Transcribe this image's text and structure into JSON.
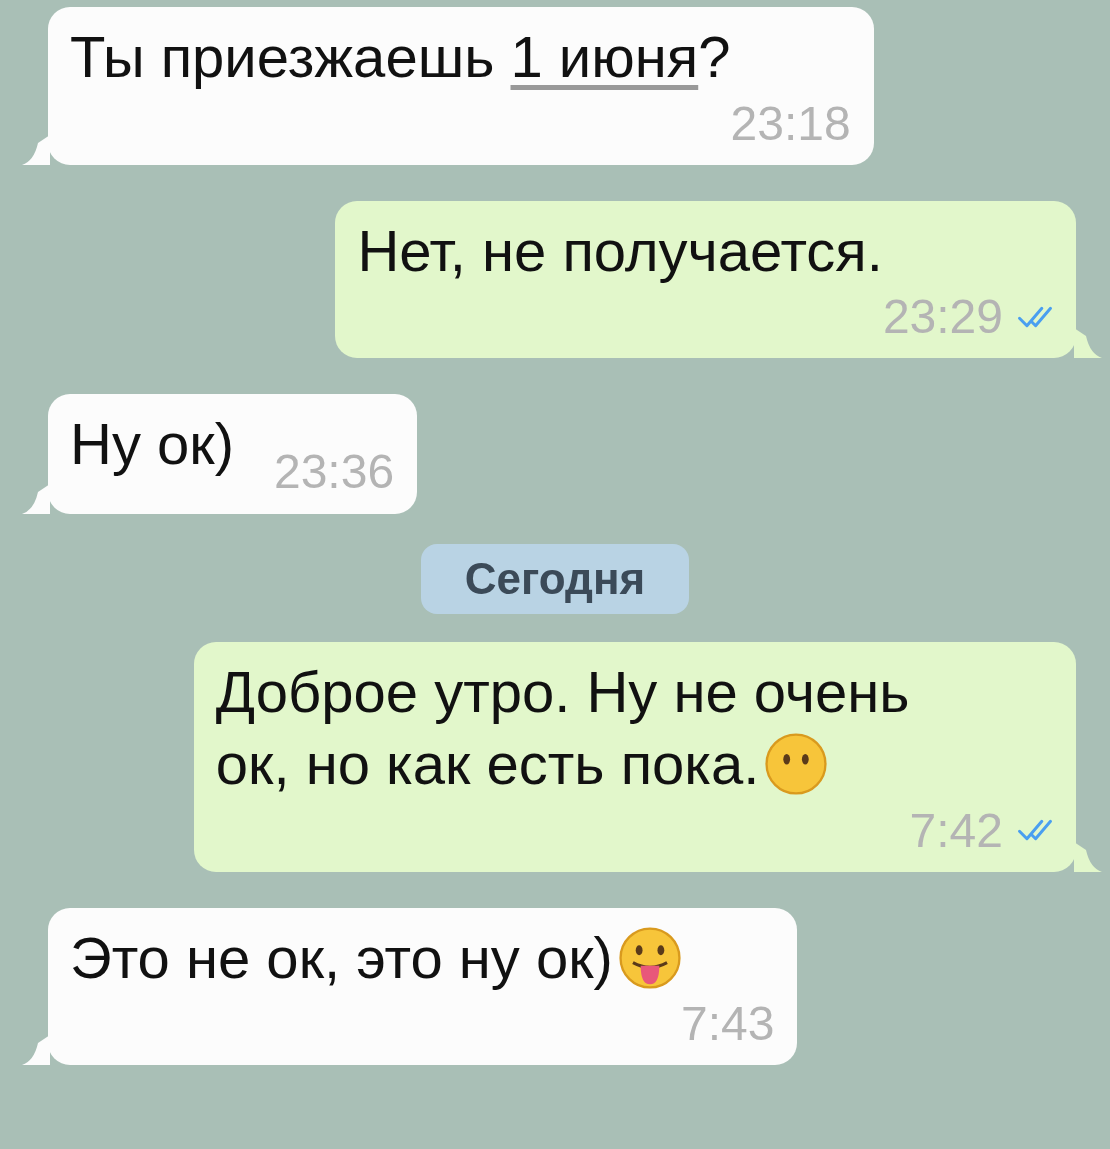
{
  "messages": [
    {
      "kind": "in",
      "lines": [
        [
          {
            "kind": "text",
            "text": "Ты приезжаешь "
          },
          {
            "kind": "link",
            "text": "1 июня"
          },
          {
            "kind": "text",
            "text": "?"
          }
        ]
      ],
      "time": "23:18"
    },
    {
      "kind": "out",
      "lines": [
        [
          {
            "kind": "text",
            "text": "Нет, не получается."
          }
        ]
      ],
      "time": "23:29",
      "read": true
    },
    {
      "kind": "in",
      "lines": [
        [
          {
            "kind": "text",
            "text": "Ну ок)"
          }
        ]
      ],
      "time": "23:36"
    },
    {
      "kind": "date",
      "text": "Сегодня"
    },
    {
      "kind": "out",
      "lines": [
        [
          {
            "kind": "text",
            "text": "Доброе утро. Ну не очень"
          }
        ],
        [
          {
            "kind": "text",
            "text": "ок, но как есть пока."
          },
          {
            "kind": "neutral-face"
          }
        ]
      ],
      "time": "7:42",
      "read": true
    },
    {
      "kind": "in",
      "lines": [
        [
          {
            "kind": "text",
            "text": "Это не ок, это ну ок)"
          },
          {
            "kind": "tongue-face"
          }
        ]
      ],
      "time": "7:43"
    }
  ]
}
